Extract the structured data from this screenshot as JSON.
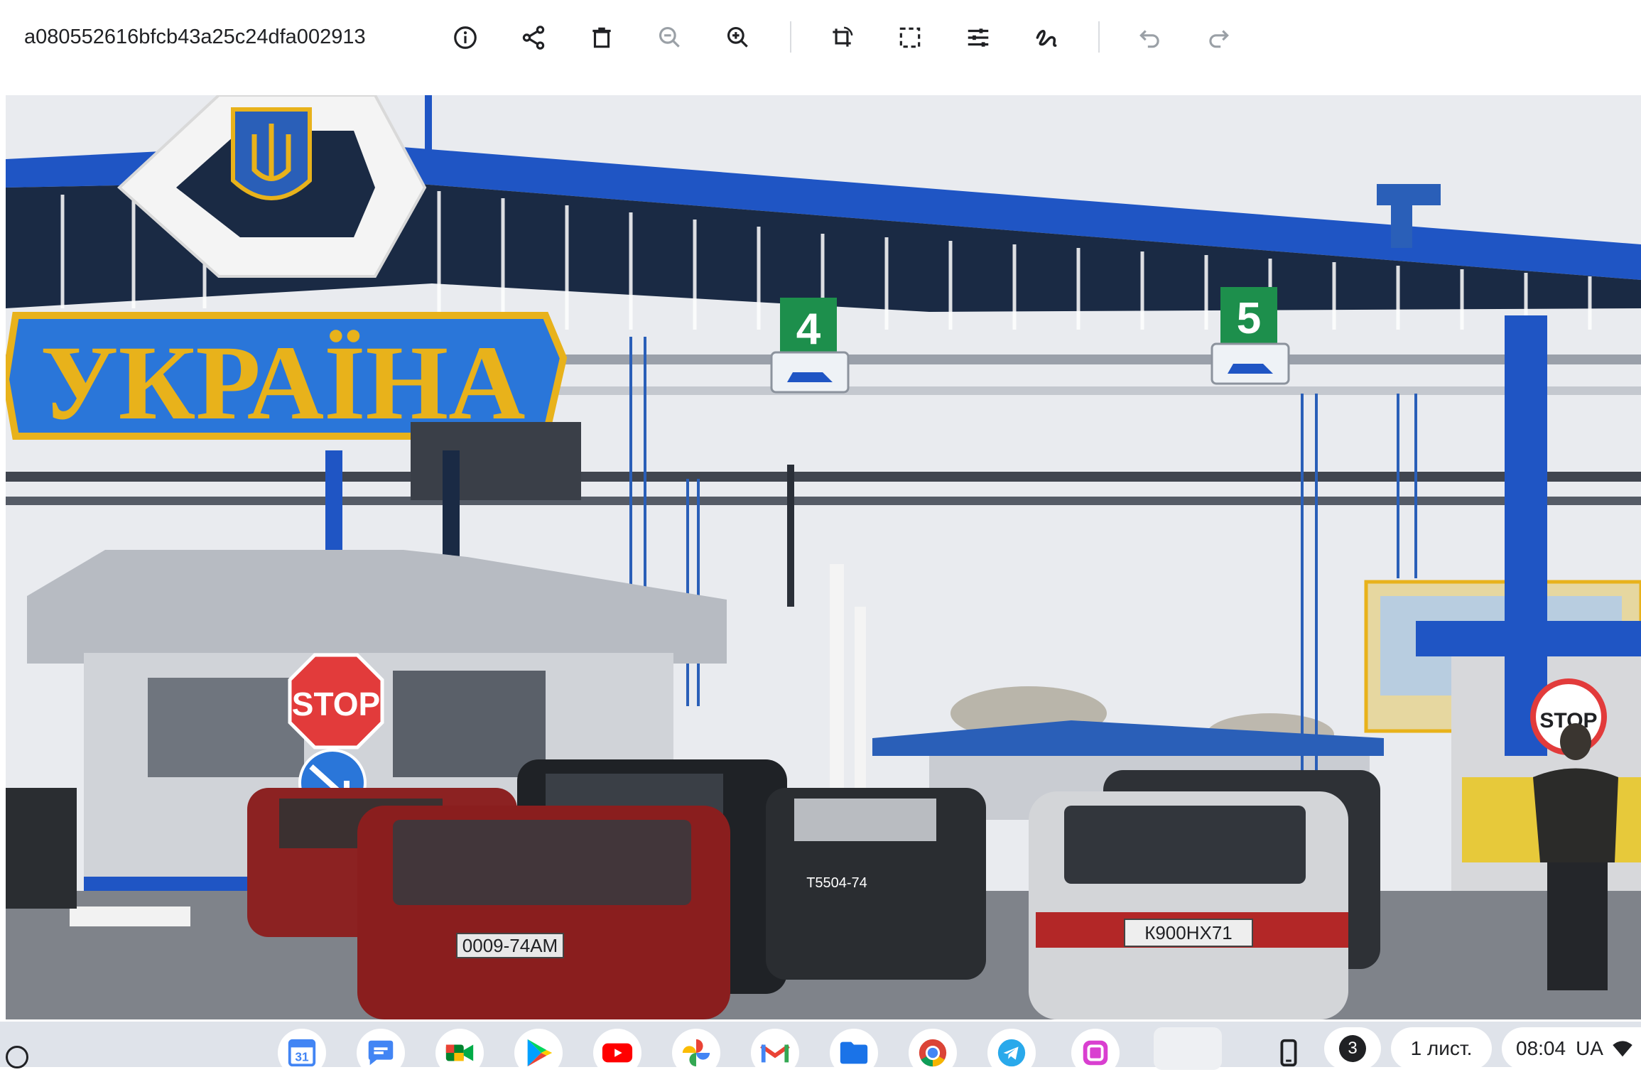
{
  "toolbar": {
    "filename": "a080552616bfcb43a25c24dfa002913",
    "buttons": [
      {
        "name": "info-icon",
        "label": "Info"
      },
      {
        "name": "share-icon",
        "label": "Share"
      },
      {
        "name": "delete-icon",
        "label": "Delete"
      },
      {
        "name": "zoom-out-icon",
        "label": "Zoom out"
      },
      {
        "name": "zoom-in-icon",
        "label": "Zoom in"
      },
      {
        "name": "rotate-crop-icon",
        "label": "Rotate"
      },
      {
        "name": "crop-icon",
        "label": "Crop"
      },
      {
        "name": "adjust-icon",
        "label": "Adjust"
      },
      {
        "name": "markup-icon",
        "label": "Markup"
      },
      {
        "name": "undo-icon",
        "label": "Undo"
      },
      {
        "name": "redo-icon",
        "label": "Redo"
      }
    ]
  },
  "photo": {
    "sign_text": "УКРАЇНА",
    "lane_4": "4",
    "lane_5": "5",
    "stop_sign": "STOP",
    "stop_sign_2": "STOP",
    "plate_1": "0009-74AM",
    "plate_2": "К900НХ71",
    "plate_3": "Т5504-74",
    "colors": {
      "canopy_blue": "#1f55c4",
      "sign_yellow": "#e8b21b",
      "sky": "#e9ebef"
    }
  },
  "shelf": {
    "apps": [
      {
        "name": "calendar-app-icon",
        "label": "31"
      },
      {
        "name": "messages-app-icon"
      },
      {
        "name": "meet-app-icon"
      },
      {
        "name": "play-store-app-icon"
      },
      {
        "name": "youtube-app-icon"
      },
      {
        "name": "photos-app-icon"
      },
      {
        "name": "gmail-app-icon"
      },
      {
        "name": "files-app-icon"
      },
      {
        "name": "chrome-app-icon"
      },
      {
        "name": "telegram-app-icon"
      },
      {
        "name": "screenshot-app-icon"
      }
    ],
    "notification_count": "3",
    "keyboard_layout": "1 лист.",
    "time": "08:04",
    "language": "UA"
  }
}
